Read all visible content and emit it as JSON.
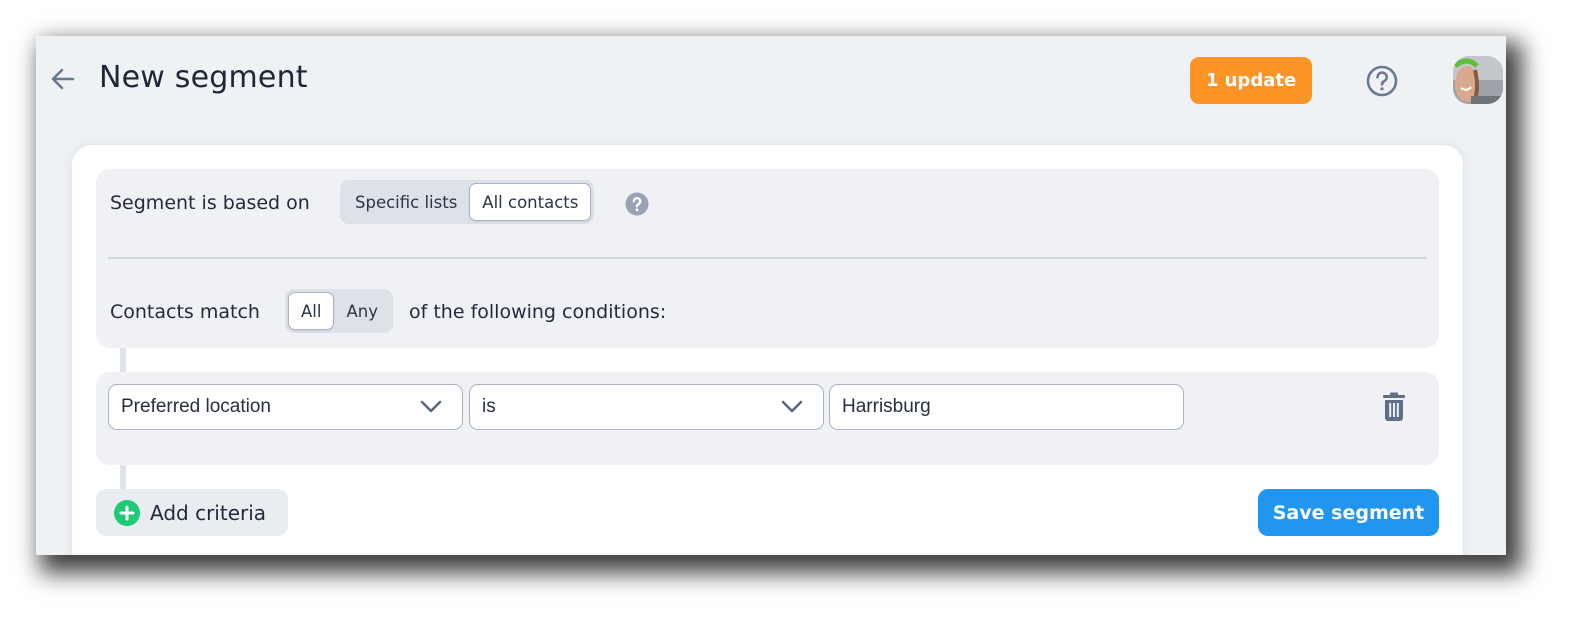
{
  "header": {
    "title": "New segment",
    "back_icon": "arrow-left-icon",
    "update_button": "1 update",
    "help_icon": "question-circle-icon",
    "avatar_alt": "user-avatar"
  },
  "segment_basis": {
    "label": "Segment is based on",
    "options": [
      "Specific lists",
      "All contacts"
    ],
    "selected": "All contacts",
    "info_icon": "question-badge-icon"
  },
  "match": {
    "label": "Contacts match",
    "options": [
      "All",
      "Any"
    ],
    "selected": "All",
    "suffix": "of the following conditions:"
  },
  "conditions": [
    {
      "field": "Preferred location",
      "operator": "is",
      "value": "Harrisburg"
    }
  ],
  "actions": {
    "add_criteria": "Add criteria",
    "save_segment": "Save segment"
  },
  "colors": {
    "update_orange": "#fd9426",
    "save_blue": "#2196f0",
    "add_green": "#1ecb74"
  }
}
